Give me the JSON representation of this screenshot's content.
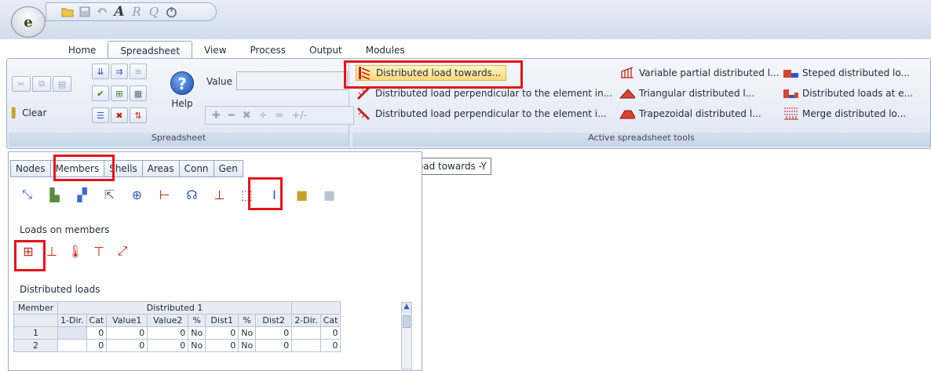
{
  "app": {
    "logo_letter": "e"
  },
  "qat": {
    "icons": [
      "open-folder-icon",
      "save-icon",
      "undo-icon",
      "bold-a-icon",
      "report-icon",
      "preview-icon",
      "power-icon"
    ]
  },
  "tabs": [
    "Home",
    "Spreadsheet",
    "View",
    "Process",
    "Output",
    "Modules"
  ],
  "active_tab": "Spreadsheet",
  "ribbon": {
    "spreadsheet_group": {
      "clear_label": "Clear",
      "help_label": "Help",
      "value_label": "Value",
      "title": "Spreadsheet"
    },
    "tools_group": {
      "title": "Active spreadsheet tools",
      "col1": [
        "Distributed load towards...",
        "Distributed load perpendicular to the element in...",
        "Distributed load perpendicular to the element i..."
      ],
      "col2": [
        "Variable partial distributed l...",
        "Triangular distributed l...",
        "Trapezoidal distributed l..."
      ],
      "col3": [
        "Steped distributed lo...",
        "Distributed loads at e...",
        "Merge distributed lo..."
      ]
    }
  },
  "tooltip": "Distributed load towards -Y",
  "panel": {
    "tabs": [
      "Nodes",
      "Members",
      "Shells",
      "Areas",
      "Conn",
      "Gen"
    ],
    "active_tab": "Members",
    "loads_title": "Loads on members",
    "dist_title": "Distributed loads"
  },
  "table": {
    "h_member": "Member",
    "h_group": "Distributed 1",
    "cols": [
      "1-Dir.",
      "Cat",
      "Value1",
      "Value2",
      "%",
      "Dist1",
      "%",
      "Dist2",
      "2-Dir.",
      "Cat"
    ],
    "rows": [
      [
        "1",
        "",
        "0",
        "0",
        "0",
        "No",
        "0",
        "No",
        "0",
        "",
        "0"
      ],
      [
        "2",
        "",
        "0",
        "0",
        "0",
        "No",
        "0",
        "No",
        "0",
        "",
        "0"
      ]
    ]
  }
}
